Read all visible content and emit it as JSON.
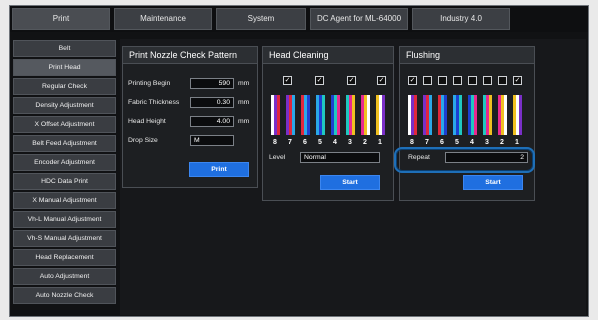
{
  "tabs": [
    {
      "label": "Print"
    },
    {
      "label": "Maintenance"
    },
    {
      "label": "System"
    },
    {
      "label": "DC Agent for ML-64000"
    },
    {
      "label": "Industry 4.0"
    }
  ],
  "sidebar": {
    "items": [
      {
        "label": "Belt"
      },
      {
        "label": "Print Head"
      },
      {
        "label": "Regular Check"
      },
      {
        "label": "Density Adjustment"
      },
      {
        "label": "X Offset Adjustment"
      },
      {
        "label": "Belt Feed Adjustment"
      },
      {
        "label": "Encoder Adjustment"
      },
      {
        "label": "HDC Data Print"
      },
      {
        "label": "X Manual Adjustment"
      },
      {
        "label": "Vh-L Manual Adjustment"
      },
      {
        "label": "Vh-S Manual Adjustment"
      },
      {
        "label": "Head Replacement"
      },
      {
        "label": "Auto Adjustment"
      },
      {
        "label": "Auto Nozzle Check"
      }
    ]
  },
  "nozzle_check": {
    "title": "Print Nozzle Check Pattern",
    "printing_begin": {
      "label": "Printing Begin",
      "value": "590",
      "unit": "mm"
    },
    "fabric_thickness": {
      "label": "Fabric Thickness",
      "value": "0.30",
      "unit": "mm"
    },
    "head_height": {
      "label": "Head Height",
      "value": "4.00",
      "unit": "mm"
    },
    "drop_size": {
      "label": "Drop Size",
      "value": "M"
    },
    "print_button": "Print"
  },
  "head_cleaning": {
    "title": "Head Cleaning",
    "checkboxes": [
      true,
      true,
      true,
      true
    ],
    "numbers": [
      "8",
      "7",
      "6",
      "5",
      "4",
      "3",
      "2",
      "1"
    ],
    "level_label": "Level",
    "level_value": "Normal",
    "start_button": "Start"
  },
  "flushing": {
    "title": "Flushing",
    "checkboxes": [
      true,
      false,
      false,
      false,
      false,
      false,
      false,
      true
    ],
    "numbers": [
      "8",
      "7",
      "6",
      "5",
      "4",
      "3",
      "2",
      "1"
    ],
    "repeat_label": "Repeat",
    "repeat_value": "2",
    "start_button": "Start"
  },
  "ink_colors": [
    "#ffffff",
    "#7a2fc8",
    "#e0283c",
    "#2aa8e8",
    "#1d3fd0",
    "#20c8c0",
    "#e82890",
    "#f0c020"
  ],
  "checked_glyph": "☑",
  "accent_color": "#1f6fe0"
}
